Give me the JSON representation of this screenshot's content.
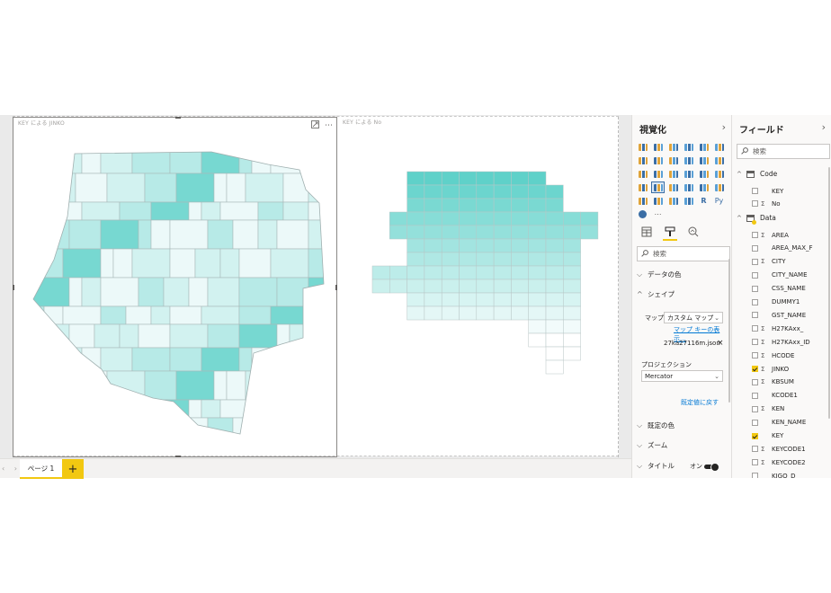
{
  "canvas": {
    "visual1_title": "KEY による JINKO",
    "visual2_title": "KEY による No",
    "more_icon": "⋯"
  },
  "tabs": {
    "nav": "‹ ›",
    "page_label": "ページ 1",
    "add_label": "+"
  },
  "viz_pane": {
    "title": "視覚化",
    "chevron": "›",
    "more": "⋯",
    "search_placeholder": "検索",
    "sections": {
      "data_colors": "データの色",
      "shape": "シェイプ",
      "default_colors": "既定の色",
      "zoom": "ズーム",
      "title": "タイトル"
    },
    "map_label": "マップ",
    "map_value": "カスタム マップ",
    "map_keys_link": "マップ キーの表示...",
    "file_name": "27ka27116m.json",
    "projection_label": "プロジェクション",
    "projection_value": "Mercator",
    "reset_default": "既定値に戻す",
    "title_toggle_label": "オン"
  },
  "fields_pane": {
    "title": "フィールド",
    "chevron": "›",
    "search_placeholder": "検索",
    "tables": [
      {
        "name": "Code",
        "fields": [
          {
            "name": "KEY",
            "sigma": false,
            "checked": false
          },
          {
            "name": "No",
            "sigma": true,
            "checked": false
          }
        ]
      },
      {
        "name": "Data",
        "fields": [
          {
            "name": "AREA",
            "sigma": true,
            "checked": false
          },
          {
            "name": "AREA_MAX_F",
            "sigma": false,
            "checked": false
          },
          {
            "name": "CITY",
            "sigma": true,
            "checked": false
          },
          {
            "name": "CITY_NAME",
            "sigma": false,
            "checked": false
          },
          {
            "name": "CSS_NAME",
            "sigma": false,
            "checked": false
          },
          {
            "name": "DUMMY1",
            "sigma": false,
            "checked": false
          },
          {
            "name": "GST_NAME",
            "sigma": false,
            "checked": false
          },
          {
            "name": "H27KAxx_",
            "sigma": true,
            "checked": false
          },
          {
            "name": "H27KAxx_ID",
            "sigma": true,
            "checked": false
          },
          {
            "name": "HCODE",
            "sigma": true,
            "checked": false
          },
          {
            "name": "JINKO",
            "sigma": true,
            "checked": true
          },
          {
            "name": "KBSUM",
            "sigma": true,
            "checked": false
          },
          {
            "name": "KCODE1",
            "sigma": false,
            "checked": false
          },
          {
            "name": "KEN",
            "sigma": true,
            "checked": false
          },
          {
            "name": "KEN_NAME",
            "sigma": false,
            "checked": false
          },
          {
            "name": "KEY",
            "sigma": false,
            "checked": true
          },
          {
            "name": "KEYCODE1",
            "sigma": true,
            "checked": false
          },
          {
            "name": "KEYCODE2",
            "sigma": true,
            "checked": false
          },
          {
            "name": "KIGO_D",
            "sigma": false,
            "checked": false
          }
        ]
      }
    ]
  },
  "colors": {
    "accent": "#f2c811",
    "map_dark": "#5fd1c9",
    "map_light": "#f7fcfc"
  }
}
